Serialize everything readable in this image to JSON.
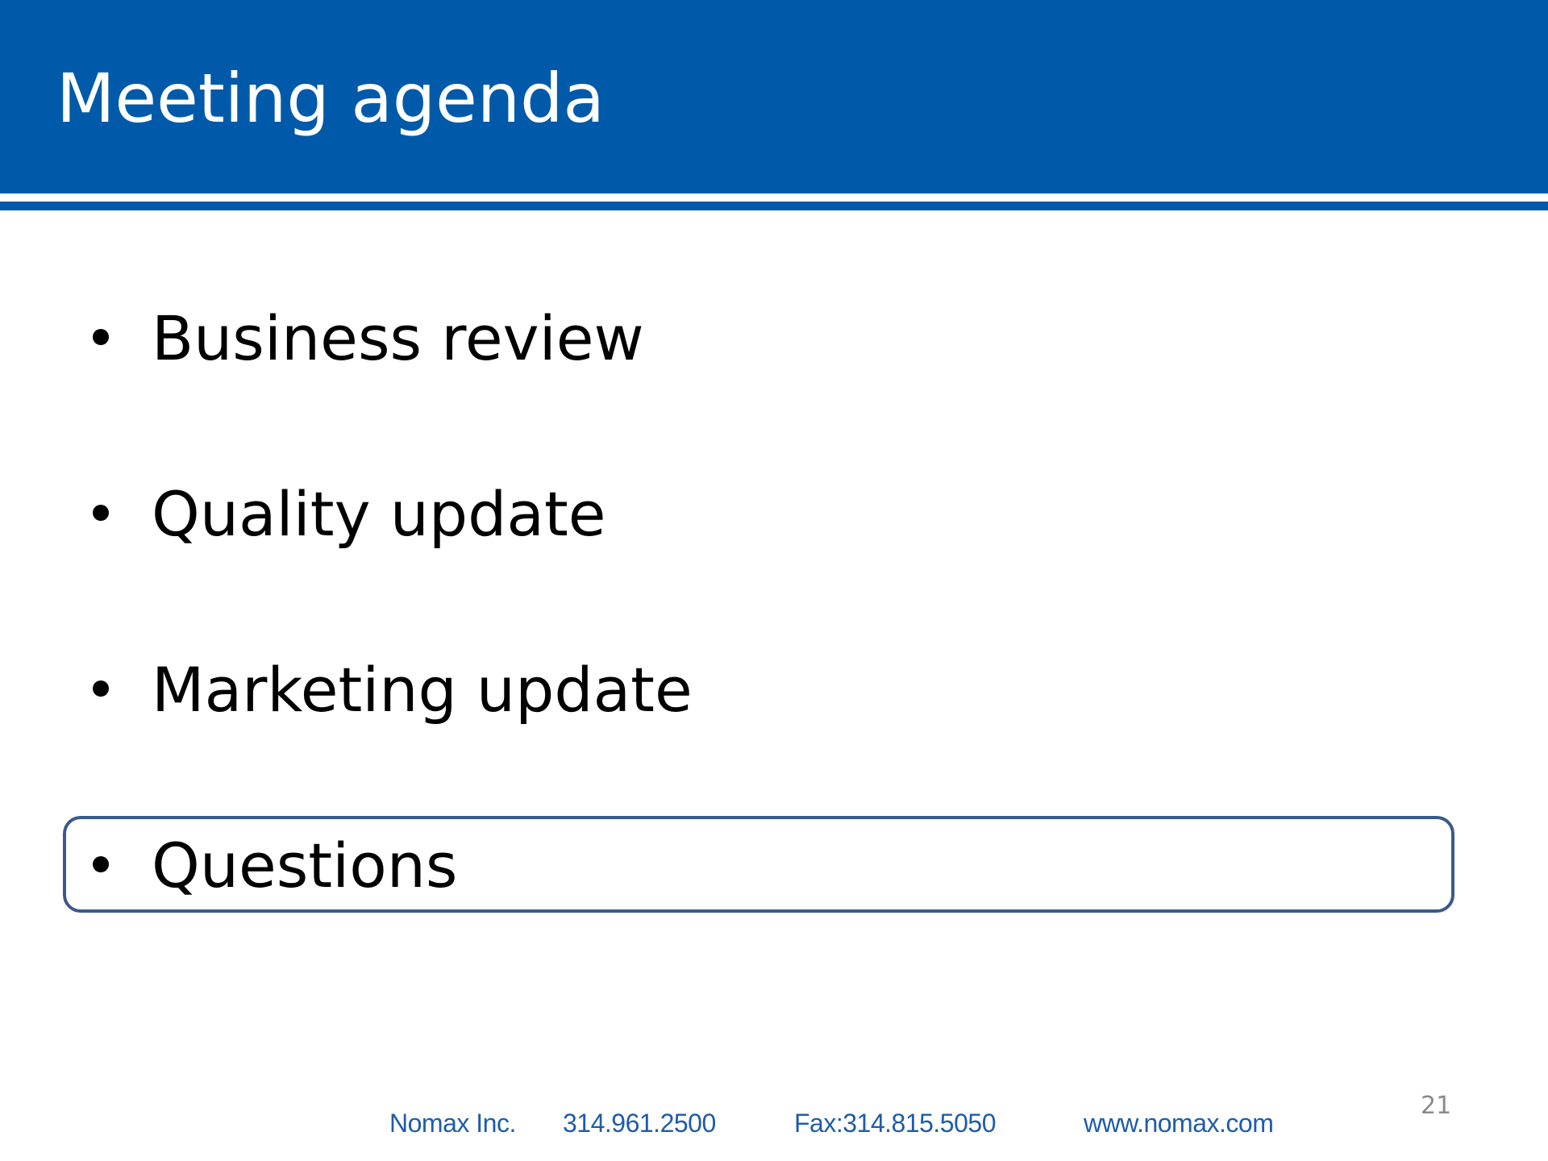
{
  "header": {
    "title": "Meeting agenda",
    "accent_color": "#005aa9"
  },
  "agenda": {
    "items": [
      {
        "label": "Business review"
      },
      {
        "label": "Quality update"
      },
      {
        "label": "Marketing update"
      },
      {
        "label": "Questions",
        "highlighted": true
      }
    ]
  },
  "footer": {
    "company": "Nomax Inc.",
    "phone": "314.961.2500",
    "fax": "Fax:314.815.5050",
    "website": "www.nomax.com",
    "text_color": "#1f5ca8"
  },
  "page_number": "21"
}
